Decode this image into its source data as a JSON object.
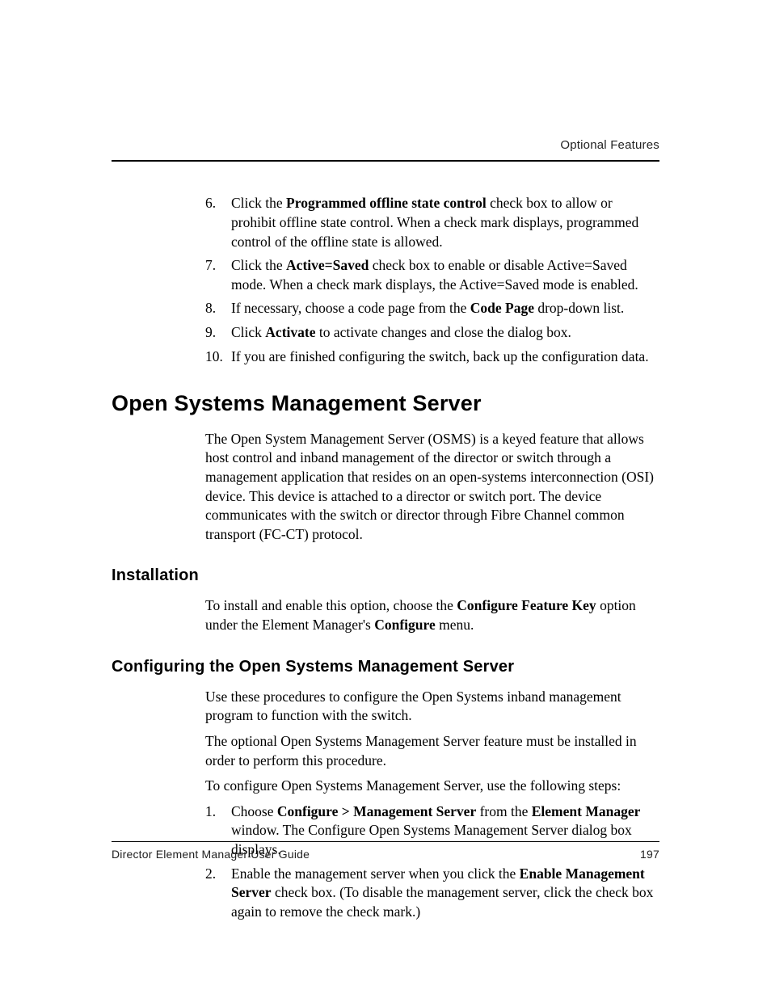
{
  "header": {
    "label": "Optional Features"
  },
  "list1": {
    "items": [
      {
        "num": "6.",
        "pre": "Click the ",
        "bold": "Programmed offline state control",
        "post": " check box to allow or prohibit offline state control. When a check mark displays, programmed control of the offline state is allowed."
      },
      {
        "num": "7.",
        "pre": "Click the ",
        "bold": "Active=Saved",
        "post": " check box to enable or disable Active=Saved mode. When a check mark displays, the Active=Saved mode is enabled."
      },
      {
        "num": "8.",
        "pre": "If necessary, choose a code page from the ",
        "bold": "Code Page",
        "post": " drop-down list."
      },
      {
        "num": "9.",
        "pre": "Click ",
        "bold": "Activate",
        "post": " to activate changes and close the dialog box."
      },
      {
        "num": "10.",
        "pre": "If you are finished configuring the switch, back up the configuration data.",
        "bold": "",
        "post": ""
      }
    ]
  },
  "section": {
    "heading": "Open Systems Management Server",
    "intro": "The Open System Management Server (OSMS) is a keyed feature that allows host control and inband management of the director or switch through a management application that resides on an open-systems interconnection (OSI) device. This device is attached to a director or switch port. The device communicates with the switch or director through Fibre Channel common transport (FC-CT) protocol."
  },
  "install": {
    "heading": "Installation",
    "p1_pre": "To install and enable this option, choose the ",
    "p1_b1": "Configure Feature Key",
    "p1_mid": " option under the Element Manager's ",
    "p1_b2": "Configure",
    "p1_post": " menu."
  },
  "config": {
    "heading": "Configuring the Open Systems Management Server",
    "p1": "Use these procedures to configure the Open Systems inband management program to function with the switch.",
    "p2": "The optional Open Systems Management Server feature must be installed in order to perform this procedure.",
    "p3": "To configure Open Systems Management Server, use the following steps:",
    "items": [
      {
        "num": "1.",
        "seg1": "Choose ",
        "b1": "Configure > Management Server",
        "seg2": " from the ",
        "b2": "Element Manager",
        "seg3": " window. The Configure Open Systems Management Server dialog box displays."
      },
      {
        "num": "2.",
        "seg1": "Enable the management server when you click the ",
        "b1": "Enable Management Server",
        "seg2": " check box. (To disable the management server, click the check box again to remove the check mark.)",
        "b2": "",
        "seg3": ""
      }
    ]
  },
  "footer": {
    "title": "Director Element Manager User Guide",
    "page": "197"
  }
}
